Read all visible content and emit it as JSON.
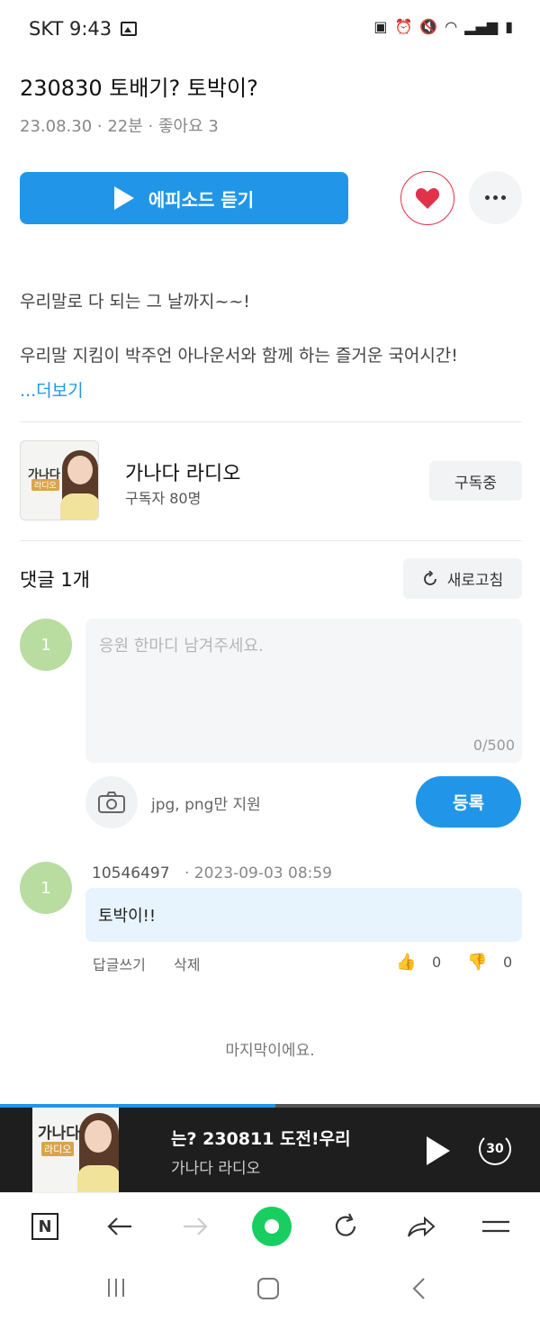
{
  "status_bar": {
    "carrier_time": "SKT 9:43",
    "icons": [
      "image-icon",
      "battery-saver-icon",
      "alarm-icon",
      "mute-icon",
      "wifi-icon",
      "signal-icon",
      "battery-icon"
    ]
  },
  "episode": {
    "title": "230830 토배기? 토박이?",
    "meta": "23.08.30 · 22분 · 좋아요 3",
    "play_label": "에피소드 듣기",
    "desc_line1": "우리말로 다 되는 그 날까지~~!",
    "desc_line2": "우리말 지킴이 박주언 아나운서와 함께 하는 즐거운 국어시간!",
    "more_label": "...더보기",
    "like_color": "#e0324a"
  },
  "channel": {
    "thumb_title": "가나다",
    "thumb_sub": "라디오",
    "name": "가나다 라디오",
    "subscribers": "구독자 80명",
    "subscribe_label": "구독중"
  },
  "comments": {
    "title": "댓글 1개",
    "refresh_label": "새로고침",
    "my_avatar": "1",
    "placeholder": "응원 한마디 남겨주세요.",
    "char_count": "0/500",
    "image_note": "jpg, png만 지원",
    "submit_label": "등록",
    "items": [
      {
        "avatar": "1",
        "author": "10546497",
        "date": "· 2023-09-03 08:59",
        "text": "토박이!!",
        "reply_label": "답글쓰기",
        "delete_label": "삭제",
        "likes": "0",
        "dislikes": "0"
      }
    ],
    "end_note": "마지막이에요."
  },
  "mini_player": {
    "thumb_title": "가나다",
    "thumb_sub": "라디오",
    "title": "는?        230811 도전!우리",
    "channel": "가나다 라디오",
    "skip_label": "30",
    "progress": 0.51,
    "accent": "#2196e8"
  },
  "browser_bar": {
    "n_label": "N",
    "icons": [
      "naver-home-icon",
      "back-arrow-icon",
      "forward-arrow-icon",
      "green-dot-icon",
      "reload-icon",
      "share-icon",
      "menu-icon"
    ]
  },
  "colors": {
    "accent": "#2196e8",
    "avatar": "#b9dca0",
    "green": "#19ce60"
  }
}
